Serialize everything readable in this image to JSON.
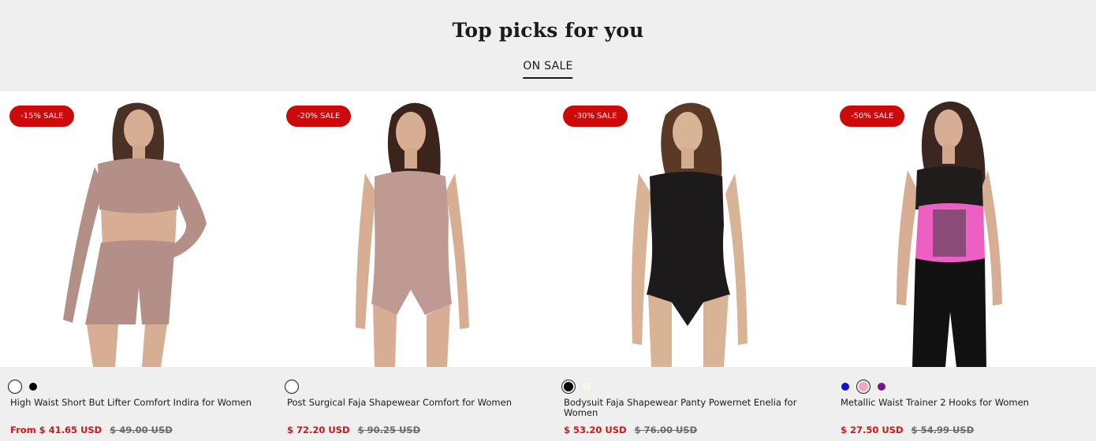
{
  "section": {
    "title": "Top picks for you",
    "tab_label": "ON SALE"
  },
  "products": [
    {
      "badge": "-15% SALE",
      "title": "High Waist Short But Lifter Comfort Indira for Women",
      "price": "From $ 41.65 USD",
      "compare_price": "$ 49.00 USD",
      "swatches": [
        {
          "color": "#ffffff",
          "selected": true
        },
        {
          "color": "#000000",
          "selected": false
        }
      ],
      "garment_color": "#b38f88",
      "hair_color": "#4a3025"
    },
    {
      "badge": "-20% SALE",
      "title": "Post Surgical Faja Shapewear Comfort for Women",
      "price": "$ 72.20 USD",
      "compare_price": "$ 90.25 USD",
      "swatches": [
        {
          "color": "#ffffff",
          "selected": true
        }
      ],
      "garment_color": "#bf9a92",
      "hair_color": "#3a241c"
    },
    {
      "badge": "-30% SALE",
      "title": "Bodysuit Faja Shapewear Panty Powernet Enelia for Women",
      "price": "$ 53.20 USD",
      "compare_price": "$ 76.00 USD",
      "swatches": [
        {
          "color": "#000000",
          "selected": true
        },
        {
          "color": "#fbf6e6",
          "selected": false
        }
      ],
      "garment_color": "#1c1a1a",
      "hair_color": "#5a3a26"
    },
    {
      "badge": "-50% SALE",
      "title": "Metallic Waist Trainer 2 Hooks for Women",
      "price": "$ 27.50 USD",
      "compare_price": "$ 54.99 USD",
      "swatches": [
        {
          "color": "#1010d8",
          "selected": false
        },
        {
          "color": "#f0a8c0",
          "selected": true
        },
        {
          "color": "#7a168a",
          "selected": false
        }
      ],
      "garment_color": "#ee5fc4",
      "hair_color": "#3b2620"
    }
  ]
}
